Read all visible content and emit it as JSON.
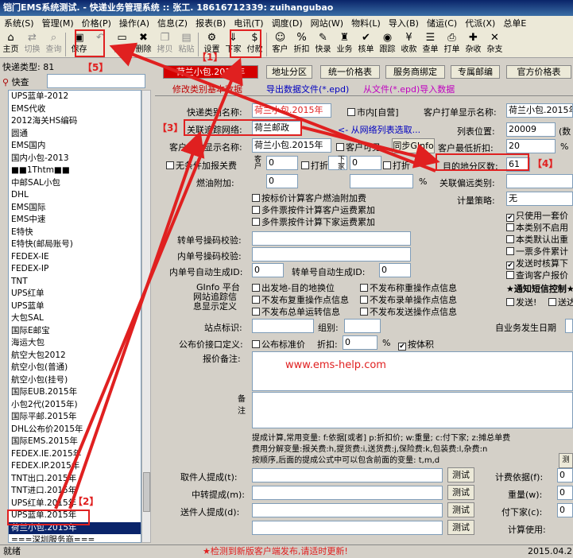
{
  "title": "铠门EMS系统测试. - 快递业务管理系统 :: 张工. 18616712339: zuihangubao",
  "menu": [
    "系统(S)",
    "管理(M)",
    "价格(P)",
    "操作(A)",
    "信息(Z)",
    "报表(B)",
    "电讯(T)",
    "调度(D)",
    "网站(W)",
    "物料(L)",
    "导入(B)",
    "储运(C)",
    "代派(X)",
    "总单E"
  ],
  "toolbar": [
    {
      "label": "主页",
      "icon": "home-icon",
      "glyph": "⌂",
      "dis": false
    },
    {
      "label": "切换",
      "icon": "switch-icon",
      "glyph": "⇄",
      "dis": true
    },
    {
      "label": "查询",
      "icon": "query-icon",
      "glyph": "⌕",
      "dis": true
    },
    {
      "label": "保存",
      "icon": "save-icon",
      "glyph": "▣",
      "dis": false
    },
    {
      "label": "",
      "icon": "undo-icon",
      "glyph": "↶",
      "dis": true
    },
    {
      "label": "清除",
      "icon": "clear-icon",
      "glyph": "▭",
      "dis": false
    },
    {
      "label": "删除",
      "icon": "delete-icon",
      "glyph": "✖",
      "dis": false
    },
    {
      "label": "拷贝",
      "icon": "copy-icon",
      "glyph": "❐",
      "dis": true
    },
    {
      "label": "粘贴",
      "icon": "paste-icon",
      "glyph": "▤",
      "dis": true
    },
    {
      "label": "设置",
      "icon": "settings-icon",
      "glyph": "⚙",
      "dis": false
    },
    {
      "label": "下家",
      "icon": "downstream-icon",
      "glyph": "⇓",
      "dis": false
    },
    {
      "label": "付款",
      "icon": "payment-icon",
      "glyph": "$",
      "dis": false
    },
    {
      "label": "客户",
      "icon": "customer-icon",
      "glyph": "☺",
      "dis": false
    },
    {
      "label": "折扣",
      "icon": "discount-icon",
      "glyph": "%",
      "dis": false
    },
    {
      "label": "快录",
      "icon": "quick-entry-icon",
      "glyph": "✎",
      "dis": false
    },
    {
      "label": "业务",
      "icon": "business-icon",
      "glyph": "♜",
      "dis": false
    },
    {
      "label": "核单",
      "icon": "verify-icon",
      "glyph": "✔",
      "dis": false
    },
    {
      "label": "跟踪",
      "icon": "track-icon",
      "glyph": "◉",
      "dis": false
    },
    {
      "label": "收款",
      "icon": "receive-icon",
      "glyph": "¥",
      "dis": false
    },
    {
      "label": "查单",
      "icon": "find-order-icon",
      "glyph": "☰",
      "dis": false
    },
    {
      "label": "打单",
      "icon": "print-icon",
      "glyph": "⎙",
      "dis": false
    },
    {
      "label": "杂收",
      "icon": "misc-income-icon",
      "glyph": "✚",
      "dis": false
    },
    {
      "label": "杂支",
      "icon": "misc-expense-icon",
      "glyph": "✕",
      "dis": false
    }
  ],
  "left": {
    "type_label": "快递类型: 81",
    "search_label": "快查",
    "items": [
      "UPS蓝单-2012",
      "EMS代收",
      "2012海关HS编码",
      "圆通",
      "EMS国内",
      "国内小包-2013",
      "■■1Thtm■■",
      "中邮SAL小包",
      "DHL",
      "EMS国际",
      "EMS中速",
      "E特快",
      "E特快(邮局账号)",
      "FEDEX-IE",
      "FEDEX-IP",
      "TNT",
      "UPS红单",
      "UPS蓝单",
      "大包SAL",
      "国际E邮宝",
      "海运大包",
      "航空大包2012",
      "航空小包(普通)",
      "航空小包(挂号)",
      "国际EUB.2015年",
      "小包2代(2015年)",
      "国际平邮.2015年",
      "DHL公布价2015年",
      "国际EMS.2015年",
      "FEDEX.IE.2015年",
      "FEDEX.IP.2015年",
      "TNT出口.2015年",
      "TNT进口.2015年",
      "UPS红单.2015年",
      "UPS蓝单.2015年",
      "荷兰小包.2015年",
      "===深圳服务商==="
    ],
    "selected_index": 35
  },
  "tabs": {
    "active": "荷兰小包.2015年",
    "t2": "地址分区",
    "t3": "统一价格表",
    "t4": "服务商绑定",
    "t5": "专属邮编",
    "t6": "官方价格表"
  },
  "subtabs": {
    "s1": "修改类别基本数据",
    "s2": "导出数据文件(*.epd)",
    "s3": "从文件(*.epd)导入数据"
  },
  "form": {
    "name_label": "快递类别名称:",
    "name_value": "荷兰小包.2015年",
    "chk_market": "市内[自营]",
    "client_print_label": "客户打单显示名称:",
    "client_print_value": "荷兰小包.2015年",
    "network_label": "关联追踪网络:",
    "network_value": "荷兰邮政",
    "network_hint": "<- 从网络列表选取...",
    "list_pos_label": "列表位置:",
    "list_pos_value": "20009",
    "list_pos_unit": "(数",
    "client_entry_label": "客户录单显示名称:",
    "client_entry_value": "荷兰小包.2015年",
    "chk_client": "客户可见",
    "sync_btn": "同步GInfo",
    "min_discount_label": "客户最低折扣:",
    "min_discount_value": "20",
    "pct": "%",
    "chk_fuel": "无条件加报关费",
    "client_side": "客户",
    "discount": "打折",
    "down_side": "下家",
    "zone_label": "目的地分区数:",
    "zone_value": "61",
    "fuel_label": "燃油附加:",
    "zero": "0",
    "chk_a": "按标价计算客户燃油附加费",
    "chk_b": "多件票按件计算客户运费累加",
    "chk_c": "多件票按件计算下家运费累加",
    "related_label": "关联偏远类别:",
    "plan_label": "计量策略:",
    "plan_value": "无",
    "r1": "只使用一套价",
    "r2": "本类别不启用",
    "r3": "本类默认出重",
    "r4": "一票多件累计",
    "r5": "发送时核算下",
    "r6": "查询客户报价",
    "r7": "★通知短信控制★",
    "r8": "发送!",
    "r9": "送达",
    "trans_label": "转单号操码校验:",
    "inner_label": "内单号操码校验:",
    "inner_auto_label": "内单号自动生成ID:",
    "trans_auto_label": "转单号自动生成ID:",
    "ginfo_l": "GInfo 平台",
    "track_l": "网站追踪信",
    "show_l": "息显示定义",
    "c1": "出发地-目的地换位",
    "c2": "不发布称重操作点信息",
    "c3": "不发布复重操作点信息",
    "c4": "不发布录单操作点信息",
    "c5": "不发布总单运转信息",
    "c6": "不发布发送操作点信息",
    "site_label": "站点标识:",
    "group_label": "组别:",
    "self_biz_label": "自业务发生日期",
    "pub_label": "公布价接口定义:",
    "chk_pub": "公布标准价",
    "discount2": "折扣:",
    "pct2": "%",
    "chk_vol": "按体积",
    "quote_label": "报价备注:",
    "watermark": "www.ems-help.com",
    "remark_label": "备注",
    "formula1": "提成计算,常用变量: f:依据[或者] p:折扣价; w:重量; c:付下家; z:摊总单费",
    "formula2": "费用分解变量:报关费:h,提货费:i,送货费:j,保险费:k,包装费:l,杂费:n",
    "formula3": "按顺序,后面的提成公式中可以包含前面的变量: t,m,d",
    "take_label": "取件人提成(t):",
    "mid_label": "中转提成(m):",
    "send_label": "送件人提成(d):",
    "test": "测试",
    "calc_basis": "计费依据(f):",
    "weight": "重量(w):",
    "pay_down": "付下家(c):",
    "calc_use": "计算使用:",
    "test_top": "测试"
  },
  "annotations": {
    "n1": "【1】",
    "n2": "【2】",
    "n3": "【3】",
    "n4": "【4】",
    "n5": "【5】"
  },
  "status": {
    "ready": "就绪",
    "notice": "★检测到新版客户端发布,请适时更新!",
    "date": "2015.04.2"
  }
}
